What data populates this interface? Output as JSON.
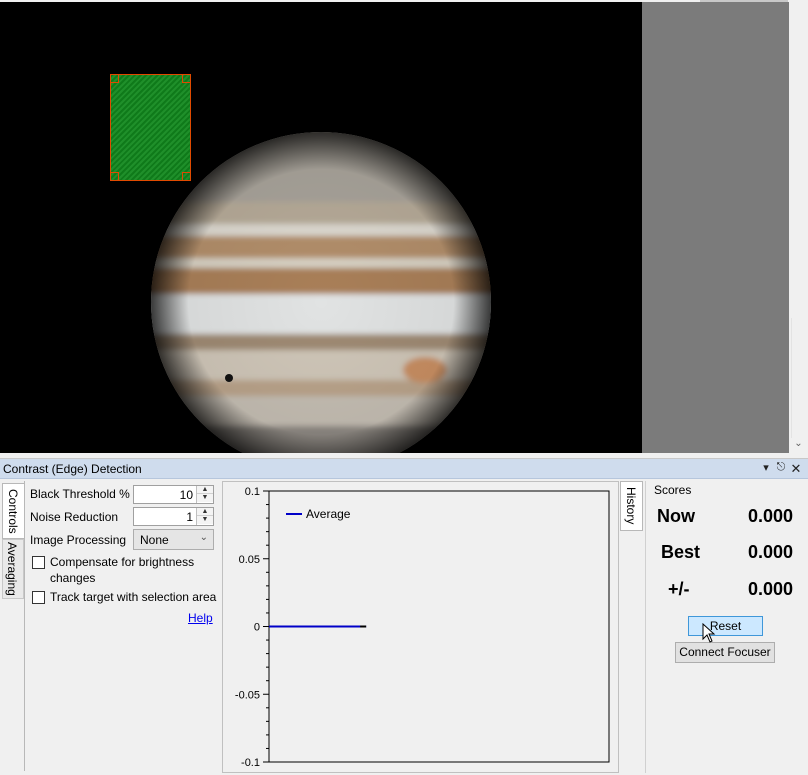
{
  "panel": {
    "title": "Contrast (Edge) Detection",
    "title_controls": [
      "dropdown-icon",
      "pin-icon",
      "close-icon"
    ]
  },
  "tabs": {
    "controls": "Controls",
    "averaging": "Averaging",
    "history": "History"
  },
  "controls": {
    "black_threshold_label": "Black Threshold %",
    "black_threshold_value": "10",
    "noise_reduction_label": "Noise Reduction",
    "noise_reduction_value": "1",
    "image_processing_label": "Image Processing",
    "image_processing_value": "None",
    "compensate_label": "Compensate for brightness changes",
    "compensate_checked": false,
    "track_label": "Track target with selection area",
    "track_checked": false,
    "help_link": "Help"
  },
  "chart_data": {
    "type": "line",
    "series": [
      {
        "name": "Average",
        "color": "#0000c8",
        "x": [
          0,
          1
        ],
        "values": [
          0,
          0
        ]
      }
    ],
    "yticks": [
      "0.1",
      "0.05",
      "0",
      "-0.05",
      "-0.1"
    ],
    "ylim": [
      -0.1,
      0.1
    ],
    "xlim": [
      0,
      3.5
    ],
    "legend": "top-left"
  },
  "scores": {
    "title": "Scores",
    "now_label": "Now",
    "now_value": "0.000",
    "best_label": "Best",
    "best_value": "0.000",
    "delta_label": "+/-",
    "delta_value": "0.000",
    "reset_label": "Reset",
    "connect_focuser_label": "Connect Focuser"
  },
  "colors": {
    "selection_border": "#e04a00",
    "selection_fill": "#1f8f2a",
    "title_bar": "#cfdced",
    "reset_button": "#cce8ff"
  }
}
